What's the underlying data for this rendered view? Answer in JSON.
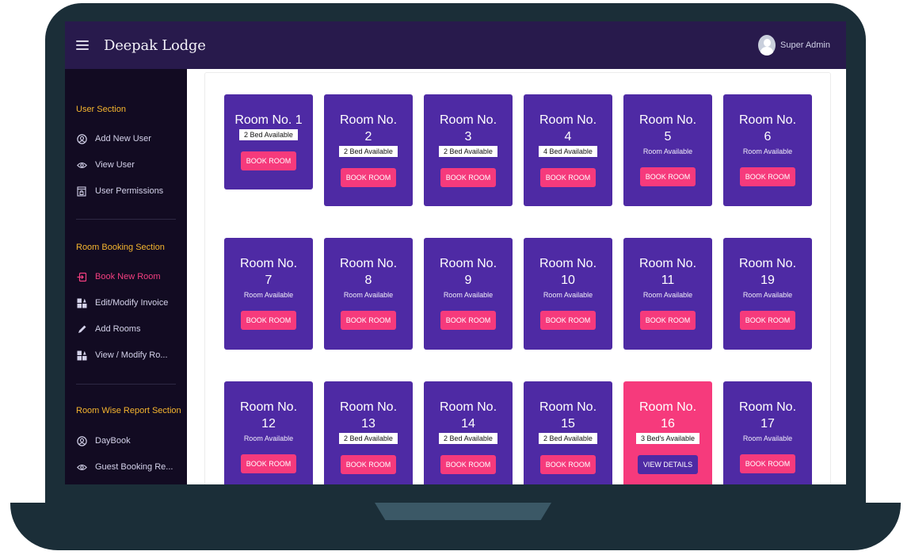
{
  "header": {
    "app_title": "Deepak Lodge",
    "user_name": "Super Admin",
    "menu_icon": "hamburger-icon",
    "avatar_icon": "user-avatar-icon"
  },
  "sidebar": {
    "sections": [
      {
        "title": "User Section",
        "items": [
          {
            "label": "Add New User",
            "icon": "user-circle-icon"
          },
          {
            "label": "View User",
            "icon": "eye-icon"
          },
          {
            "label": "User Permissions",
            "icon": "permission-icon"
          }
        ]
      },
      {
        "title": "Room Booking Section",
        "items": [
          {
            "label": "Book New Room",
            "icon": "login-door-icon",
            "active": true
          },
          {
            "label": "Edit/Modify Invoice",
            "icon": "grid-edit-icon"
          },
          {
            "label": "Add Rooms",
            "icon": "pencil-icon"
          },
          {
            "label": "View / Modify Ro...",
            "icon": "grid-edit-icon"
          }
        ]
      },
      {
        "title": "Room Wise Report Section",
        "items": [
          {
            "label": "DayBook",
            "icon": "user-circle-icon"
          },
          {
            "label": "Guest Booking Re...",
            "icon": "eye-icon"
          }
        ]
      }
    ]
  },
  "colors": {
    "topbar": "#281a4c",
    "sidebar": "#120b22",
    "section_title": "#f5b52f",
    "active_item": "#f43f80",
    "room_card": "#4e2aa4",
    "room_card_occupied": "#f63a7c",
    "button_pink": "#f63a7c"
  },
  "rooms": [
    {
      "title": "Room No. 1",
      "status": "2 Bed Available",
      "badge": true,
      "action": "BOOK ROOM"
    },
    {
      "title": "Room No. 2",
      "status": "2 Bed Available",
      "badge": true,
      "action": "BOOK ROOM"
    },
    {
      "title": "Room No. 3",
      "status": "2 Bed Available",
      "badge": true,
      "action": "BOOK ROOM"
    },
    {
      "title": "Room No. 4",
      "status": "4 Bed Available",
      "badge": true,
      "action": "BOOK ROOM"
    },
    {
      "title": "Room No. 5",
      "status": "Room Available",
      "badge": false,
      "action": "BOOK ROOM"
    },
    {
      "title": "Room No. 6",
      "status": "Room Available",
      "badge": false,
      "action": "BOOK ROOM"
    },
    {
      "title": "Room No. 7",
      "status": "Room Available",
      "badge": false,
      "action": "BOOK ROOM"
    },
    {
      "title": "Room No. 8",
      "status": "Room Available",
      "badge": false,
      "action": "BOOK ROOM"
    },
    {
      "title": "Room No. 9",
      "status": "Room Available",
      "badge": false,
      "action": "BOOK ROOM"
    },
    {
      "title": "Room No. 10",
      "status": "Room Available",
      "badge": false,
      "action": "BOOK ROOM"
    },
    {
      "title": "Room No. 11",
      "status": "Room Available",
      "badge": false,
      "action": "BOOK ROOM"
    },
    {
      "title": "Room No. 19",
      "status": "Room Available",
      "badge": false,
      "action": "BOOK ROOM"
    },
    {
      "title": "Room No. 12",
      "status": "Room Available",
      "badge": false,
      "action": "BOOK ROOM"
    },
    {
      "title": "Room No. 13",
      "status": "2 Bed Available",
      "badge": true,
      "action": "BOOK ROOM"
    },
    {
      "title": "Room No. 14",
      "status": "2 Bed Available",
      "badge": true,
      "action": "BOOK ROOM"
    },
    {
      "title": "Room No. 15",
      "status": "2 Bed Available",
      "badge": true,
      "action": "BOOK ROOM"
    },
    {
      "title": "Room No. 16",
      "status": "3 Bed's Available",
      "badge": true,
      "action": "VIEW DETAILS",
      "occupied": true
    },
    {
      "title": "Room No. 17",
      "status": "Room Available",
      "badge": false,
      "action": "BOOK ROOM"
    }
  ]
}
